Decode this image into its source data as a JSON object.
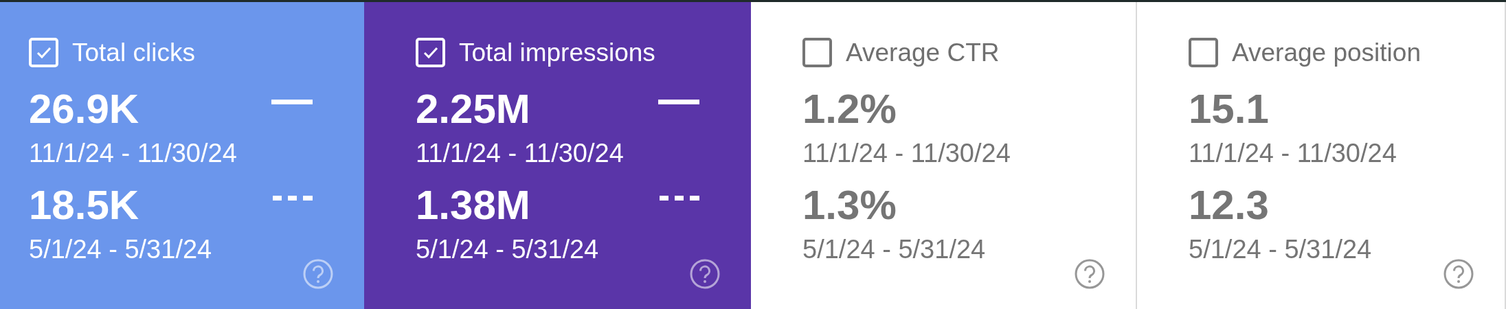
{
  "metrics": [
    {
      "label": "Total clicks",
      "checked": true,
      "color": "#6b96ec",
      "periods": [
        {
          "kind": "current",
          "value": "26.9K",
          "range": "11/1/24 - 11/30/24"
        },
        {
          "kind": "previous",
          "value": "18.5K",
          "range": "5/1/24 - 5/31/24"
        }
      ]
    },
    {
      "label": "Total impressions",
      "checked": true,
      "color": "#5a35a8",
      "periods": [
        {
          "kind": "current",
          "value": "2.25M",
          "range": "11/1/24 - 11/30/24"
        },
        {
          "kind": "previous",
          "value": "1.38M",
          "range": "5/1/24 - 5/31/24"
        }
      ]
    },
    {
      "label": "Average CTR",
      "checked": false,
      "periods": [
        {
          "kind": "current",
          "value": "1.2%",
          "range": "11/1/24 - 11/30/24"
        },
        {
          "kind": "previous",
          "value": "1.3%",
          "range": "5/1/24 - 5/31/24"
        }
      ]
    },
    {
      "label": "Average position",
      "checked": false,
      "periods": [
        {
          "kind": "current",
          "value": "15.1",
          "range": "11/1/24 - 11/30/24"
        },
        {
          "kind": "previous",
          "value": "12.3",
          "range": "5/1/24 - 5/31/24"
        }
      ]
    }
  ]
}
